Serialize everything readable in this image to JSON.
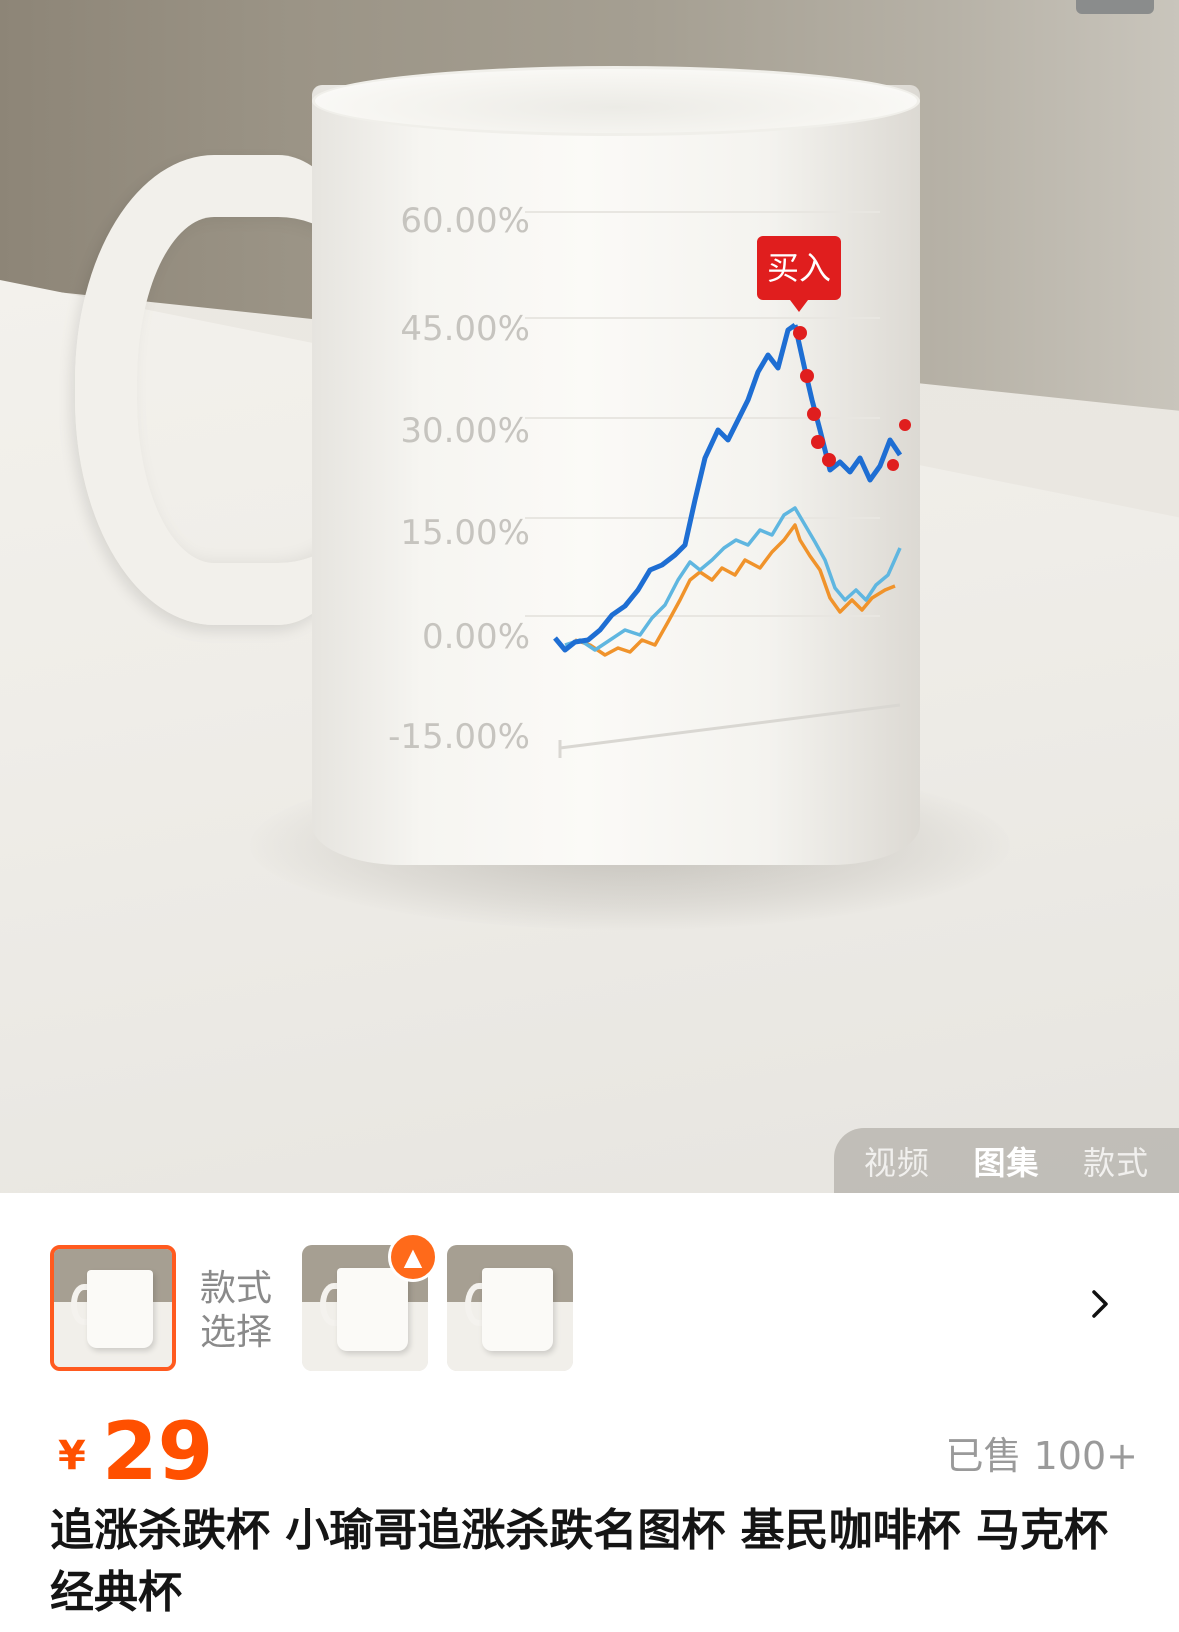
{
  "mug_chart": {
    "y_ticks": [
      "60.00%",
      "45.00%",
      "30.00%",
      "15.00%",
      "0.00%",
      "-15.00%"
    ],
    "marker_label": "买入",
    "colors": {
      "blue": "#1e6ed3",
      "cyan": "#5fb6e0",
      "orange": "#f0932b",
      "marker": "#e01e1e"
    }
  },
  "media_tabs": [
    "视频",
    "图集",
    "款式"
  ],
  "media_tabs_active": 1,
  "variant_section": {
    "label_line1": "款式",
    "label_line2": "选择"
  },
  "price": {
    "currency": "¥",
    "amount": "29"
  },
  "sold": "已售 100+",
  "title": "追涨杀跌杯 小瑜哥追涨杀跌名图杯  基民咖啡杯 马克杯 经典杯",
  "accent_color": "#ff5000"
}
